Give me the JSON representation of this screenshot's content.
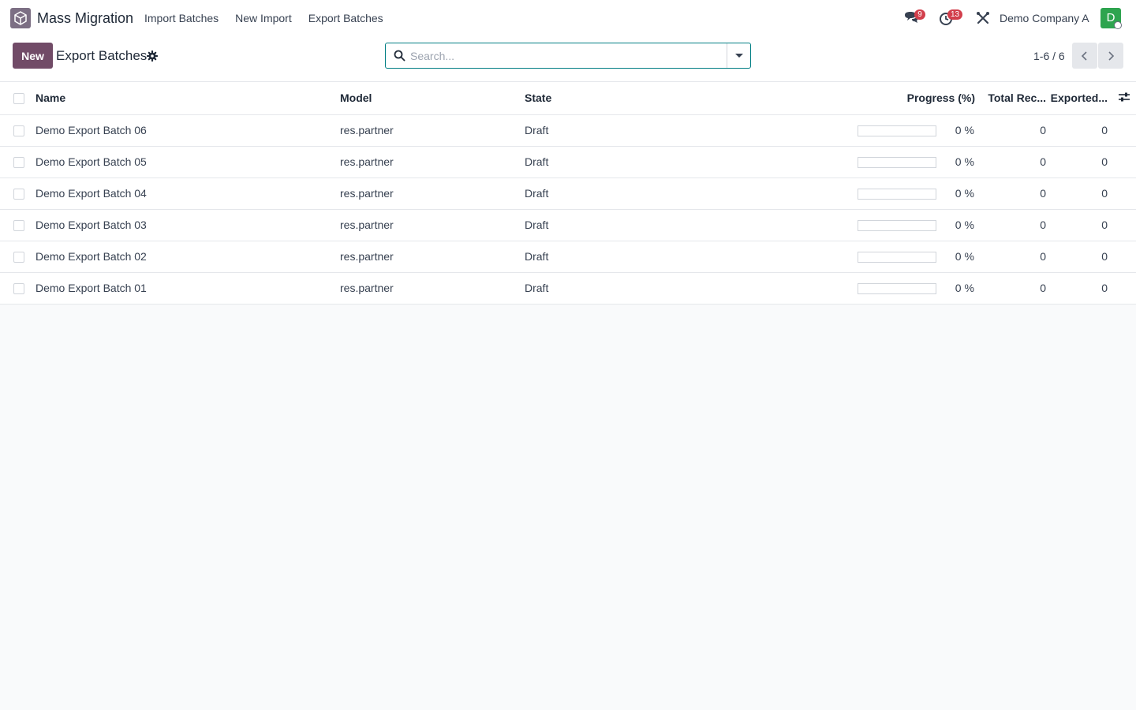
{
  "app": {
    "name": "Mass Migration",
    "logo_icon": "cube-icon",
    "menu": [
      "Import Batches",
      "New Import",
      "Export Batches"
    ]
  },
  "systray": {
    "messages_count": "9",
    "activities_count": "13",
    "company": "Demo Company A",
    "avatar_initial": "D"
  },
  "control_panel": {
    "new_label": "New",
    "title": "Export Batches",
    "search_placeholder": "Search...",
    "pager": "1-6 / 6"
  },
  "list": {
    "columns": {
      "name": "Name",
      "model": "Model",
      "state": "State",
      "progress": "Progress (%)",
      "total": "Total Rec...",
      "exported": "Exported..."
    },
    "rows": [
      {
        "name": "Demo Export Batch 06",
        "model": "res.partner",
        "state": "Draft",
        "progress": 0,
        "progress_label": "0 %",
        "total": "0",
        "exported": "0"
      },
      {
        "name": "Demo Export Batch 05",
        "model": "res.partner",
        "state": "Draft",
        "progress": 0,
        "progress_label": "0 %",
        "total": "0",
        "exported": "0"
      },
      {
        "name": "Demo Export Batch 04",
        "model": "res.partner",
        "state": "Draft",
        "progress": 0,
        "progress_label": "0 %",
        "total": "0",
        "exported": "0"
      },
      {
        "name": "Demo Export Batch 03",
        "model": "res.partner",
        "state": "Draft",
        "progress": 0,
        "progress_label": "0 %",
        "total": "0",
        "exported": "0"
      },
      {
        "name": "Demo Export Batch 02",
        "model": "res.partner",
        "state": "Draft",
        "progress": 0,
        "progress_label": "0 %",
        "total": "0",
        "exported": "0"
      },
      {
        "name": "Demo Export Batch 01",
        "model": "res.partner",
        "state": "Draft",
        "progress": 0,
        "progress_label": "0 %",
        "total": "0",
        "exported": "0"
      }
    ]
  },
  "colors": {
    "primary": "#714b67",
    "accent": "#017e84",
    "badge": "#d23f4c",
    "avatar": "#2ea44f"
  }
}
